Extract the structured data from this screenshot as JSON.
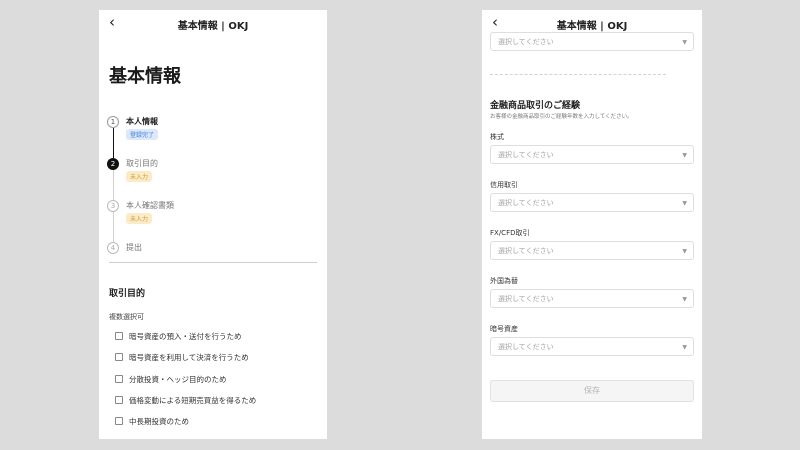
{
  "colors": {
    "background": "#dcdcdc",
    "done_badge_text": "#3b78d8",
    "done_badge_bg": "#dce9fb",
    "todo_badge_text": "#d39a2a",
    "todo_badge_bg": "#fcebc8",
    "active_step": "#111111"
  },
  "left": {
    "header": {
      "back_icon": "chevron-left-icon",
      "title": "基本情報 | OKJ"
    },
    "page_title": "基本情報",
    "steps": [
      {
        "number": "1",
        "label": "本人情報",
        "badge": "登録完了",
        "state": "done"
      },
      {
        "number": "2",
        "label": "取引目的",
        "badge": "未入力",
        "state": "active"
      },
      {
        "number": "3",
        "label": "本人確認書類",
        "badge": "未入力",
        "state": "pending"
      },
      {
        "number": "4",
        "label": "提出",
        "badge": "",
        "state": "pending"
      }
    ],
    "section_title": "取引目的",
    "multi_select_label": "複数選択可",
    "checkboxes": [
      {
        "label": "暗号資産の預入・送付を行うため",
        "checked": false
      },
      {
        "label": "暗号資産を利用して決済を行うため",
        "checked": false
      },
      {
        "label": "分散投資・ヘッジ目的のため",
        "checked": false
      },
      {
        "label": "価格変動による短期売買益を得るため",
        "checked": false
      },
      {
        "label": "中長期投資のため",
        "checked": false
      }
    ]
  },
  "right": {
    "header": {
      "back_icon": "chevron-left-icon",
      "title": "基本情報 | OKJ"
    },
    "top_select_placeholder": "選択してください",
    "section_title": "金融商品取引のご経験",
    "section_hint": "お客様の金融商品取引のご経験年数を入力してください。",
    "fields": [
      {
        "label": "株式",
        "placeholder": "選択してください"
      },
      {
        "label": "信用取引",
        "placeholder": "選択してください"
      },
      {
        "label": "FX/CFD取引",
        "placeholder": "選択してください"
      },
      {
        "label": "外国為替",
        "placeholder": "選択してください"
      },
      {
        "label": "暗号資産",
        "placeholder": "選択してください"
      }
    ],
    "save_label": "保存"
  }
}
